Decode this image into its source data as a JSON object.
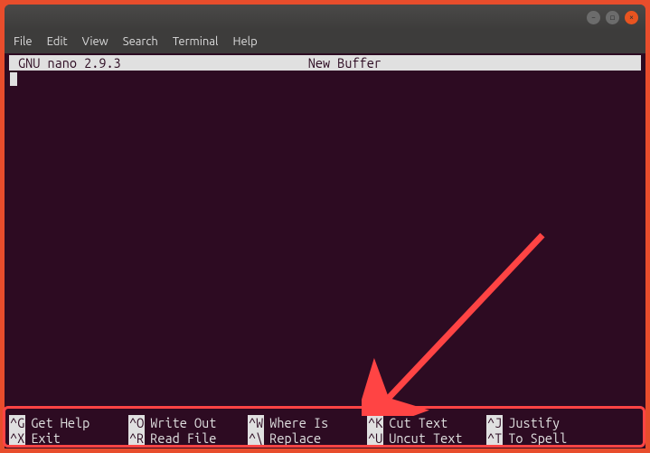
{
  "window": {
    "title": ""
  },
  "menubar": {
    "items": [
      "File",
      "Edit",
      "View",
      "Search",
      "Terminal",
      "Help"
    ]
  },
  "nano": {
    "app": "GNU nano 2.9.3",
    "buffer": "New Buffer"
  },
  "shortcuts": {
    "row1": [
      {
        "key": "^G",
        "label": "Get Help"
      },
      {
        "key": "^O",
        "label": "Write Out"
      },
      {
        "key": "^W",
        "label": "Where Is"
      },
      {
        "key": "^K",
        "label": "Cut Text"
      },
      {
        "key": "^J",
        "label": "Justify"
      }
    ],
    "row2": [
      {
        "key": "^X",
        "label": "Exit"
      },
      {
        "key": "^R",
        "label": "Read File"
      },
      {
        "key": "^\\",
        "label": "Replace"
      },
      {
        "key": "^U",
        "label": "Uncut Text"
      },
      {
        "key": "^T",
        "label": "To Spell"
      }
    ]
  }
}
